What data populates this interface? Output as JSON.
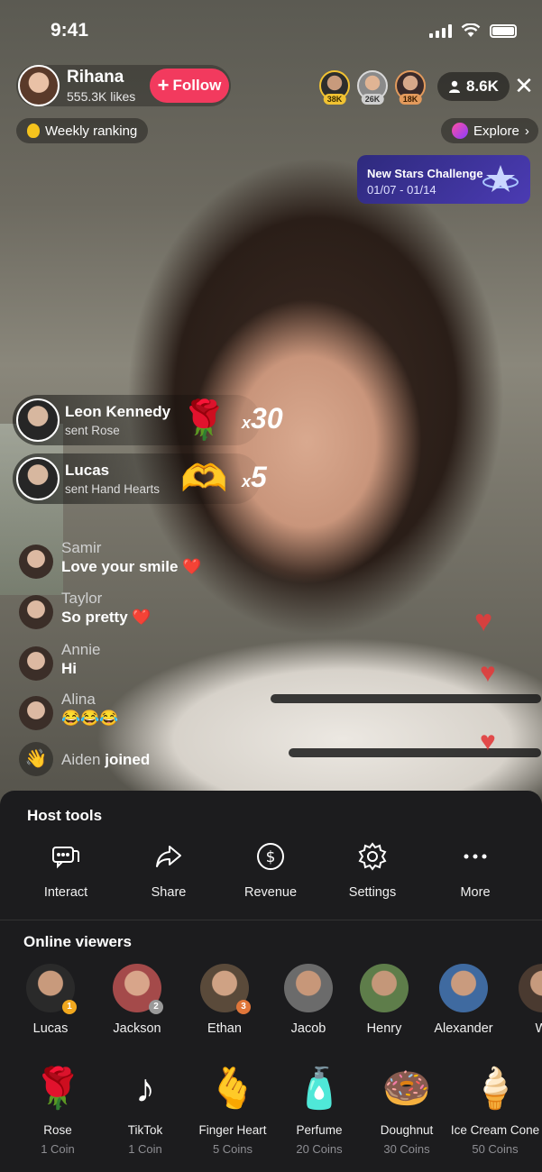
{
  "status_bar": {
    "time": "9:41"
  },
  "host": {
    "name": "Rihana",
    "likes": "555.3K likes",
    "follow_label": "Follow"
  },
  "top_viewers": [
    {
      "badge": "38K"
    },
    {
      "badge": "26K"
    },
    {
      "badge": "18K"
    }
  ],
  "viewer_count": "8.6K",
  "weekly_ranking": "Weekly ranking",
  "explore": "Explore",
  "challenge": {
    "title": "New Stars Challenge",
    "dates": "01/07 - 01/14"
  },
  "gift_notifications": [
    {
      "user": "Leon Kennedy",
      "action": "sent Rose",
      "icon": "rose-icon",
      "multiplier": "x",
      "count": "30"
    },
    {
      "user": "Lucas",
      "action": "sent Hand Hearts",
      "icon": "hand-hearts-icon",
      "multiplier": "x",
      "count": "5"
    }
  ],
  "comments": [
    {
      "user": "Samir",
      "text": "Love your smile ❤️"
    },
    {
      "user": "Taylor",
      "text": "So pretty ❤️"
    },
    {
      "user": "Annie",
      "text": "Hi"
    },
    {
      "user": "Alina",
      "text": "😂😂😂"
    }
  ],
  "join_event": {
    "user": "Aiden",
    "action": "joined"
  },
  "host_tools": {
    "title": "Host tools",
    "items": [
      {
        "label": "Interact",
        "icon": "chat-bubbles-icon"
      },
      {
        "label": "Share",
        "icon": "share-arrow-icon"
      },
      {
        "label": "Revenue",
        "icon": "dollar-icon"
      },
      {
        "label": "Settings",
        "icon": "gear-icon"
      },
      {
        "label": "More",
        "icon": "more-dots-icon"
      }
    ]
  },
  "online_viewers": {
    "title": "Online viewers",
    "items": [
      {
        "name": "Lucas",
        "rank": "1"
      },
      {
        "name": "Jackson",
        "rank": "2"
      },
      {
        "name": "Ethan",
        "rank": "3"
      },
      {
        "name": "Jacob",
        "rank": ""
      },
      {
        "name": "Henry",
        "rank": ""
      },
      {
        "name": "Alexander",
        "rank": ""
      },
      {
        "name": "Wi",
        "rank": ""
      }
    ]
  },
  "gifts": [
    {
      "name": "Rose",
      "price": "1 Coin",
      "icon": "rose-icon"
    },
    {
      "name": "TikTok",
      "price": "1 Coin",
      "icon": "tiktok-icon"
    },
    {
      "name": "Finger Heart",
      "price": "5 Coins",
      "icon": "finger-heart-icon"
    },
    {
      "name": "Perfume",
      "price": "20 Coins",
      "icon": "perfume-icon"
    },
    {
      "name": "Doughnut",
      "price": "30 Coins",
      "icon": "doughnut-icon"
    },
    {
      "name": "Ice Cream Cone",
      "price": "50 Coins",
      "icon": "ice-cream-icon"
    }
  ],
  "colors": {
    "follow": "#f23a5e",
    "sheet": "#1c1c1e",
    "heart": "#e23c3c",
    "challenge": "#3b33a0"
  }
}
